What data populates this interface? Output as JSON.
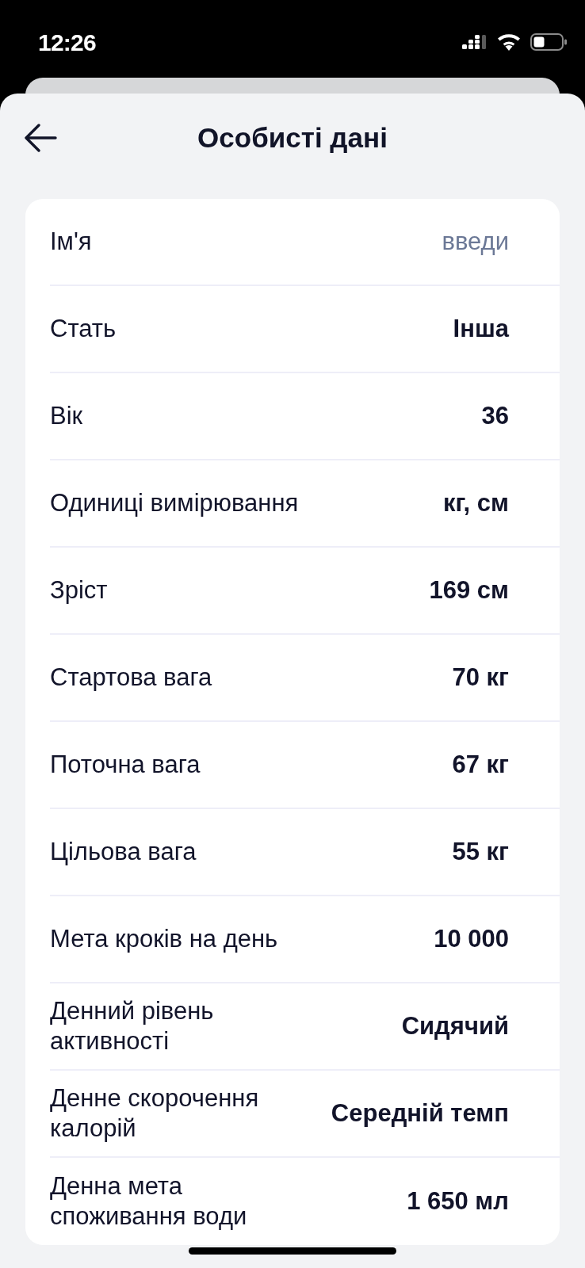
{
  "status_bar": {
    "time": "12:26"
  },
  "header": {
    "title": "Особисті дані"
  },
  "fields": [
    {
      "label": "Ім'я",
      "placeholder": "введи"
    },
    {
      "label": "Стать",
      "value": "Інша"
    },
    {
      "label": "Вік",
      "value": "36"
    },
    {
      "label": "Одиниці вимірювання",
      "value": "кг, см"
    },
    {
      "label": "Зріст",
      "value": "169 см"
    },
    {
      "label": "Стартова вага",
      "value": "70 кг"
    },
    {
      "label": "Поточна вага",
      "value": "67 кг"
    },
    {
      "label": "Цільова вага",
      "value": "55 кг"
    },
    {
      "label": "Мета кроків на день",
      "value": "10 000"
    },
    {
      "label": "Денний рівень\nактивності",
      "value": "Сидячий"
    },
    {
      "label": "Денне скорочення\nкалорій",
      "value": "Середній темп"
    },
    {
      "label": "Денна мета\nспоживання води",
      "value": "1 650 мл"
    }
  ]
}
